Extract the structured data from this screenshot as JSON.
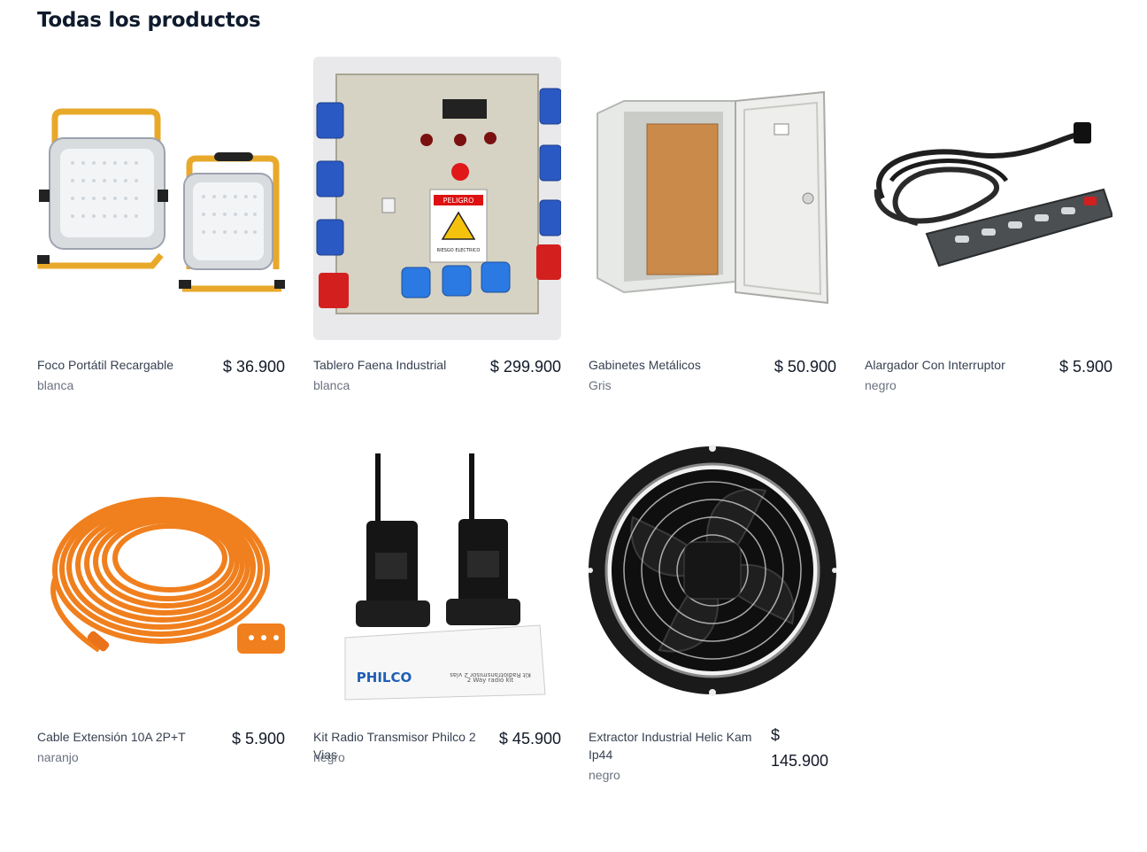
{
  "page": {
    "title": "Todas los productos"
  },
  "products": [
    {
      "name": "Foco Portátil Recargable",
      "color": "blanca",
      "price": "$ 36.900",
      "image_icon": "floodlight-icon"
    },
    {
      "name": "Tablero Faena Industrial",
      "color": "blanca",
      "price": "$ 299.900",
      "image_icon": "electrical-panel-icon"
    },
    {
      "name": "Gabinetes Metálicos",
      "color": "Gris",
      "price": "$ 50.900",
      "image_icon": "metal-cabinet-icon"
    },
    {
      "name": "Alargador Con Interruptor",
      "color": "negro",
      "price": "$ 5.900",
      "image_icon": "power-strip-icon"
    },
    {
      "name": "Cable Extensión 10A 2P+T",
      "color": "naranjo",
      "price": "$ 5.900",
      "image_icon": "extension-cable-icon"
    },
    {
      "name": "Kit Radio Transmisor Philco 2 Vias",
      "color": "negro",
      "price": "$ 45.900",
      "image_icon": "walkie-talkie-icon",
      "box_brand": "PHILCO",
      "box_text_1": "Kit Radiotransmisor 2 vías",
      "box_text_2": "2 Way radio kit"
    },
    {
      "name": "Extractor Industrial Helic Kam Ip44",
      "color": "negro",
      "price": "$ 145.900",
      "image_icon": "exhaust-fan-icon"
    }
  ],
  "panel_labels": {
    "sign": "PELIGRO",
    "sign_sub": "RIESGO ELECTRICO"
  }
}
